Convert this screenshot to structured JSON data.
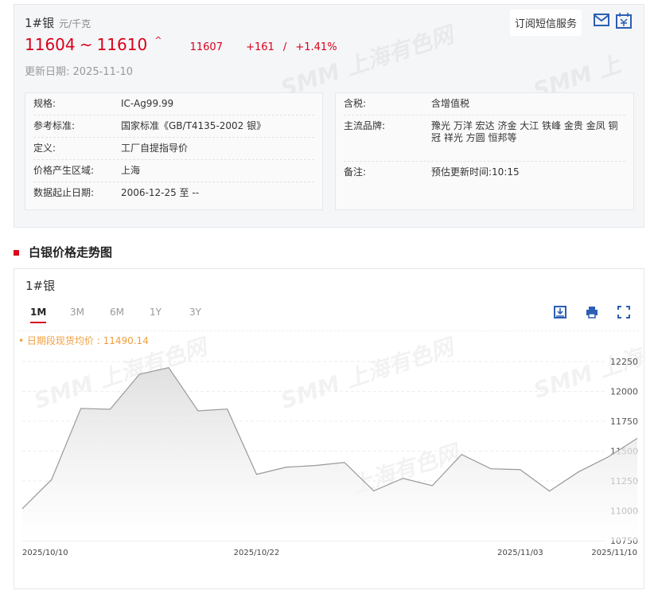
{
  "header": {
    "title": "1#银",
    "unit": "元/千克",
    "price_low": "11604",
    "tilde": "~",
    "price_high": "11610",
    "up_icon": "^",
    "avg": "11607",
    "change": "+161",
    "sep": "/",
    "change_pct": "+1.41%",
    "update_label": "更新日期:",
    "update_date": "2025-11-10",
    "sms_button": "订阅短信服务"
  },
  "specs_left": [
    {
      "k": "规格:",
      "v": "IC-Ag99.99"
    },
    {
      "k": "参考标准:",
      "v": "国家标准《GB/T4135-2002 银》"
    },
    {
      "k": "定义:",
      "v": "工厂自提指导价"
    },
    {
      "k": "价格产生区域:",
      "v": "上海"
    },
    {
      "k": "数据起止日期:",
      "v": "2006-12-25 至 --"
    }
  ],
  "specs_right": [
    {
      "k": "含税:",
      "v": "含增值税"
    },
    {
      "k": "主流品牌:",
      "v": "豫光 万洋 宏达 济金 大江 铁峰 金贵 金凤 铜冠 祥光 方圆 恒邦等"
    },
    {
      "k": "备注:",
      "v": "预估更新时间:10:15"
    }
  ],
  "section_title": "白银价格走势图",
  "chart_title": "1#银",
  "tabs": [
    "1M",
    "3M",
    "6M",
    "1Y",
    "3Y"
  ],
  "avg_note": "• 日期段现货均价 : 11490.14",
  "watermark": "SMM 上海有色网",
  "colors": {
    "red": "#d9001b",
    "blue": "#2b5fb3",
    "orange": "#f0a040"
  },
  "chart_data": {
    "type": "area",
    "ylim": [
      10750,
      12250
    ],
    "yticks": [
      12250,
      12000,
      11750,
      11500,
      11250,
      11000,
      10750
    ],
    "values": [
      11017,
      11261,
      11857,
      11850,
      12143,
      12199,
      11837,
      11852,
      11305,
      11365,
      11379,
      11405,
      11167,
      11272,
      11210,
      11472,
      11352,
      11345,
      11165,
      11327,
      11450,
      11607
    ],
    "xtick_labels": [
      {
        "i": 0,
        "label": "2025/10/10"
      },
      {
        "i": 8,
        "label": "2025/10/22"
      },
      {
        "i": 16,
        "label": "2025/11/03"
      },
      {
        "i": 21,
        "label": "2025/11/10"
      }
    ]
  }
}
